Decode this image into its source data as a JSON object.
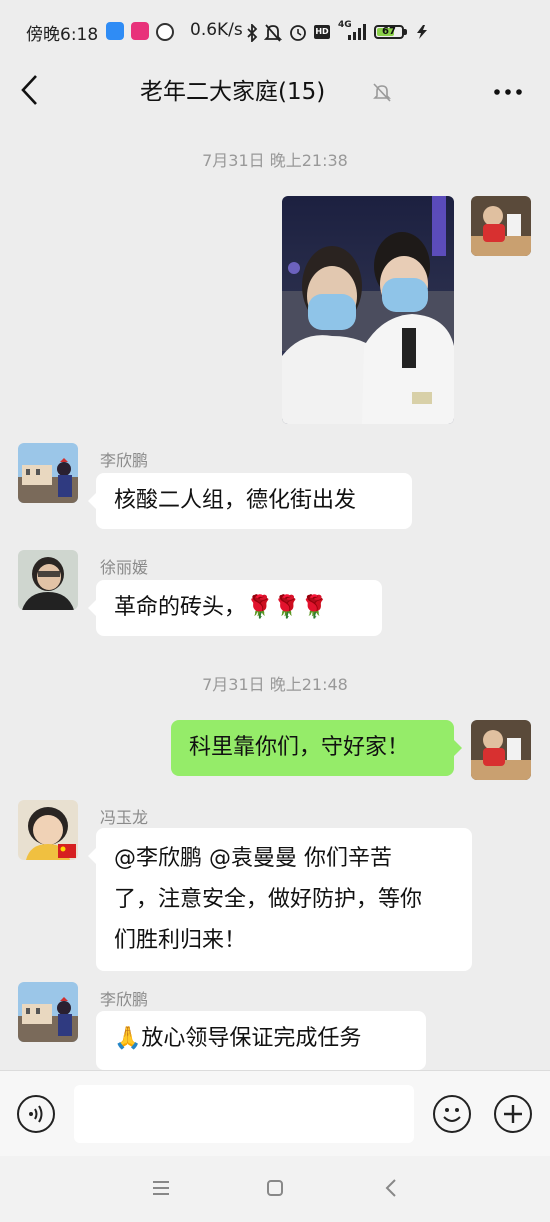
{
  "status_bar": {
    "time": "傍晚6:18",
    "net_speed": "0.6K/s",
    "battery": "67",
    "signal": "4G"
  },
  "header": {
    "title": "老年二大家庭(15)"
  },
  "messages": [
    {
      "type": "time",
      "text": "7月31日 晚上21:38"
    },
    {
      "type": "image",
      "side": "right"
    },
    {
      "type": "text",
      "side": "left",
      "sender": "李欣鹏",
      "text": "核酸二人组，德化街出发"
    },
    {
      "type": "text",
      "side": "left",
      "sender": "徐丽媛",
      "text": "革命的砖头，🌹🌹🌹"
    },
    {
      "type": "time",
      "text": "7月31日 晚上21:48"
    },
    {
      "type": "text",
      "side": "right",
      "text": "科里靠你们，守好家！"
    },
    {
      "type": "text",
      "side": "left",
      "sender": "冯玉龙",
      "lines": [
        "@李欣鹏  @袁曼曼  你们辛苦",
        "了，注意安全，做好防护，等你",
        "们胜利归来！"
      ]
    },
    {
      "type": "text",
      "side": "left",
      "sender": "李欣鹏",
      "text": "🙏放心领导保证完成任务"
    }
  ],
  "colors": {
    "background": "#ededed",
    "self_bubble": "#95ec69",
    "other_bubble": "#ffffff"
  }
}
